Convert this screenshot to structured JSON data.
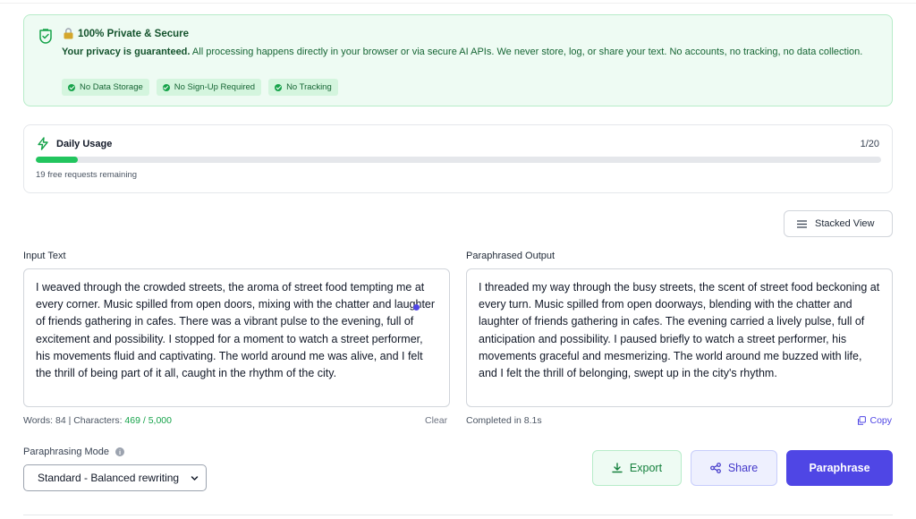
{
  "privacy": {
    "title": "100% Private & Secure",
    "desc_bold": "Your privacy is guaranteed.",
    "desc_rest": " All processing happens directly in your browser or via secure AI APIs. We never store, log, or share your text. No accounts, no tracking, no data collection.",
    "badges": [
      "No Data Storage",
      "No Sign-Up Required",
      "No Tracking"
    ],
    "colors": {
      "background": "#eefbf3",
      "border": "#b7ecc9",
      "text": "#166534"
    },
    "icons": [
      "shield-check-icon",
      "lock-icon",
      "check-circle-icon"
    ]
  },
  "usage": {
    "label": "Daily Usage",
    "count": "1/20",
    "progress_fraction": 0.05,
    "remaining": "19 free requests remaining",
    "accent": "#22c55e",
    "icon": "lightning-bolt-icon"
  },
  "view_toggle": {
    "label": "Stacked View",
    "icon": "menu-lines-icon"
  },
  "input": {
    "label": "Input Text",
    "text": "I weaved through the crowded streets, the aroma of street food tempting me at every corner. Music spilled from open doors, mixing with the chatter and laughter of friends gathering in cafes. There was a vibrant pulse to the evening, full of excitement and possibility. I stopped for a moment to watch a street performer, his movements fluid and captivating. The world around me was alive, and I felt the thrill of being part of it all, caught in the rhythm of the city.",
    "stats_prefix": "Words: 84 | Characters: ",
    "char_count": "469 / 5,000",
    "clear_label": "Clear"
  },
  "output": {
    "label": "Paraphrased Output",
    "text": "I threaded my way through the busy streets, the scent of street food beckoning at every turn. Music spilled from open doorways, blending with the chatter and laughter of friends gathering in cafes. The evening carried a lively pulse, full of anticipation and possibility. I paused briefly to watch a street performer, his movements graceful and mesmerizing. The world around me buzzed with life, and I felt the thrill of belonging, swept up in the city's rhythm.",
    "status": "Completed in 8.1s",
    "copy_label": "Copy"
  },
  "mode": {
    "label": "Paraphrasing Mode",
    "selected": "Standard - Balanced rewriting"
  },
  "actions": {
    "export_label": "Export",
    "share_label": "Share",
    "paraphrase_label": "Paraphrase",
    "primary_color": "#4f46e5"
  }
}
